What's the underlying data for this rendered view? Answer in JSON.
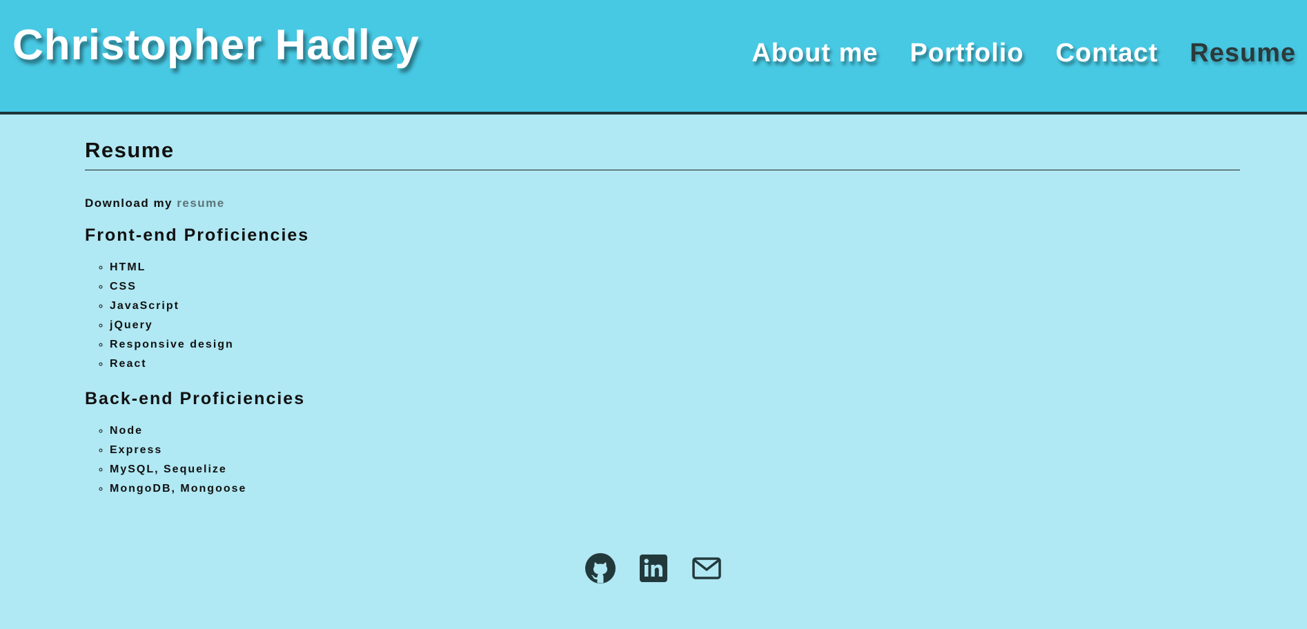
{
  "header": {
    "title": "Christopher Hadley",
    "nav": [
      {
        "label": "About me"
      },
      {
        "label": "Portfolio"
      },
      {
        "label": "Contact"
      },
      {
        "label": "Resume",
        "active": true
      }
    ]
  },
  "main": {
    "title": "Resume",
    "download_prefix": "Download my",
    "download_link": "resume",
    "frontend": {
      "heading": "Front-end Proficiencies",
      "items": [
        "HTML",
        "CSS",
        "JavaScript",
        "jQuery",
        "Responsive design",
        "React"
      ]
    },
    "backend": {
      "heading": "Back-end Proficiencies",
      "items": [
        "Node",
        "Express",
        "MySQL, Sequelize",
        "MongoDB, Mongoose"
      ]
    }
  },
  "social": [
    {
      "icon": "github-icon"
    },
    {
      "icon": "linkedin-icon"
    },
    {
      "icon": "envelope-icon"
    }
  ],
  "colors": {
    "header_bg": "#47c9e4",
    "page_bg": "#b0e8f3",
    "icon": "#22393c",
    "active_nav": "#2b3a3c"
  }
}
